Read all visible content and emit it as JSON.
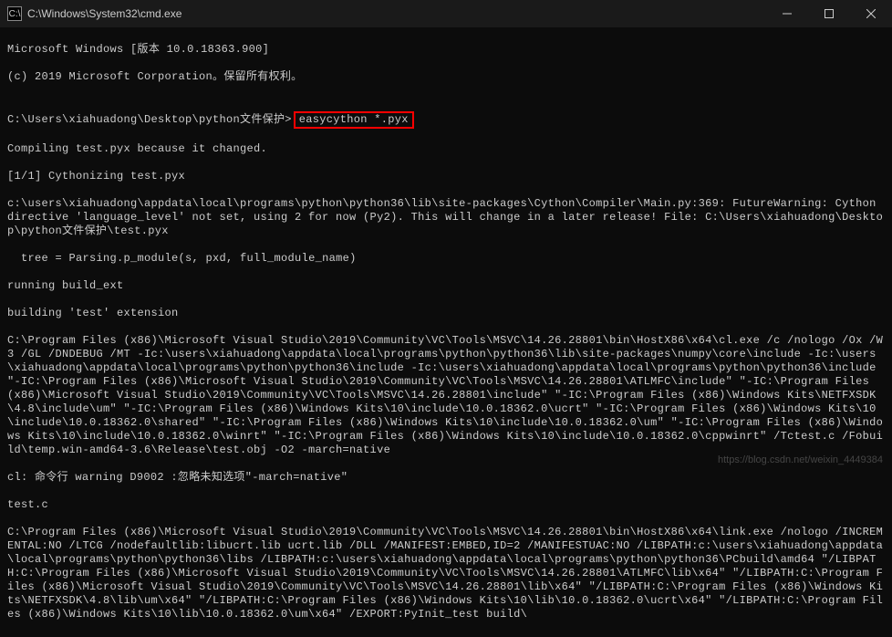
{
  "titlebar": {
    "icon_text": "C:\\",
    "title": "C:\\Windows\\System32\\cmd.exe"
  },
  "terminal": {
    "line1": "Microsoft Windows [版本 10.0.18363.900]",
    "line2": "(c) 2019 Microsoft Corporation。保留所有权利。",
    "blank1": "",
    "prompt_path": "C:\\Users\\xiahuadong\\Desktop\\python文件保护>",
    "command": "easycython *.pyx",
    "line3": "Compiling test.pyx because it changed.",
    "line4": "[1/1] Cythonizing test.pyx",
    "line5": "c:\\users\\xiahuadong\\appdata\\local\\programs\\python\\python36\\lib\\site-packages\\Cython\\Compiler\\Main.py:369: FutureWarning: Cython directive 'language_level' not set, using 2 for now (Py2). This will change in a later release! File: C:\\Users\\xiahuadong\\Desktop\\python文件保护\\test.pyx",
    "line6": "  tree = Parsing.p_module(s, pxd, full_module_name)",
    "line7": "running build_ext",
    "line8": "building 'test' extension",
    "line9": "C:\\Program Files (x86)\\Microsoft Visual Studio\\2019\\Community\\VC\\Tools\\MSVC\\14.26.28801\\bin\\HostX86\\x64\\cl.exe /c /nologo /Ox /W3 /GL /DNDEBUG /MT -Ic:\\users\\xiahuadong\\appdata\\local\\programs\\python\\python36\\lib\\site-packages\\numpy\\core\\include -Ic:\\users\\xiahuadong\\appdata\\local\\programs\\python\\python36\\include -Ic:\\users\\xiahuadong\\appdata\\local\\programs\\python\\python36\\include \"-IC:\\Program Files (x86)\\Microsoft Visual Studio\\2019\\Community\\VC\\Tools\\MSVC\\14.26.28801\\ATLMFC\\include\" \"-IC:\\Program Files (x86)\\Microsoft Visual Studio\\2019\\Community\\VC\\Tools\\MSVC\\14.26.28801\\include\" \"-IC:\\Program Files (x86)\\Windows Kits\\NETFXSDK\\4.8\\include\\um\" \"-IC:\\Program Files (x86)\\Windows Kits\\10\\include\\10.0.18362.0\\ucrt\" \"-IC:\\Program Files (x86)\\Windows Kits\\10\\include\\10.0.18362.0\\shared\" \"-IC:\\Program Files (x86)\\Windows Kits\\10\\include\\10.0.18362.0\\um\" \"-IC:\\Program Files (x86)\\Windows Kits\\10\\include\\10.0.18362.0\\winrt\" \"-IC:\\Program Files (x86)\\Windows Kits\\10\\include\\10.0.18362.0\\cppwinrt\" /Tctest.c /Fobuild\\temp.win-amd64-3.6\\Release\\test.obj -O2 -march=native",
    "line10": "cl: 命令行 warning D9002 :忽略未知选项\"-march=native\"",
    "line11": "test.c",
    "line12": "C:\\Program Files (x86)\\Microsoft Visual Studio\\2019\\Community\\VC\\Tools\\MSVC\\14.26.28801\\bin\\HostX86\\x64\\link.exe /nologo /INCREMENTAL:NO /LTCG /nodefaultlib:libucrt.lib ucrt.lib /DLL /MANIFEST:EMBED,ID=2 /MANIFESTUAC:NO /LIBPATH:c:\\users\\xiahuadong\\appdata\\local\\programs\\python\\python36\\libs /LIBPATH:c:\\users\\xiahuadong\\appdata\\local\\programs\\python\\python36\\PCbuild\\amd64 \"/LIBPATH:C:\\Program Files (x86)\\Microsoft Visual Studio\\2019\\Community\\VC\\Tools\\MSVC\\14.26.28801\\ATLMFC\\lib\\x64\" \"/LIBPATH:C:\\Program Files (x86)\\Microsoft Visual Studio\\2019\\Community\\VC\\Tools\\MSVC\\14.26.28801\\lib\\x64\" \"/LIBPATH:C:\\Program Files (x86)\\Windows Kits\\NETFXSDK\\4.8\\lib\\um\\x64\" \"/LIBPATH:C:\\Program Files (x86)\\Windows Kits\\10\\lib\\10.0.18362.0\\ucrt\\x64\" \"/LIBPATH:C:\\Program Files (x86)\\Windows Kits\\10\\lib\\10.0.18362.0\\um\\x64\" /EXPORT:PyInit_test build\\"
  },
  "watermark": "https://blog.csdn.net/weixin_4449384"
}
